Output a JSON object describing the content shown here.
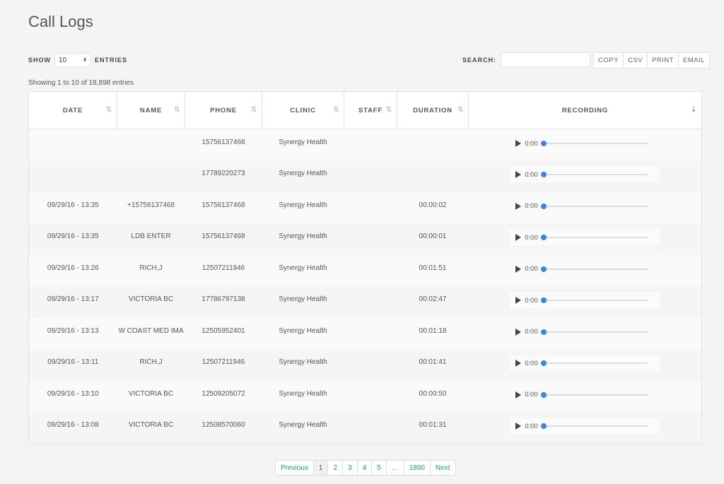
{
  "title": "Call Logs",
  "show": {
    "label": "SHOW",
    "value": "10",
    "suffix": "ENTRIES"
  },
  "search": {
    "label": "SEARCH:",
    "value": ""
  },
  "buttons": [
    "COPY",
    "CSV",
    "PRINT",
    "EMAIL"
  ],
  "info": "Showing 1 to 10 of 18,898 entries",
  "columns": [
    "DATE",
    "NAME",
    "PHONE",
    "CLINIC",
    "STAFF",
    "DURATION",
    "RECORDING"
  ],
  "rows": [
    {
      "date": "",
      "name": "",
      "phone": "15756137468",
      "clinic": "Synergy Health",
      "staff": "",
      "duration": "",
      "time": "0:00"
    },
    {
      "date": "",
      "name": "",
      "phone": "17789220273",
      "clinic": "Synergy Health",
      "staff": "",
      "duration": "",
      "time": "0:00"
    },
    {
      "date": "09/29/16 - 13:35",
      "name": "+15756137468",
      "phone": "15756137468",
      "clinic": "Synergy Health",
      "staff": "",
      "duration": "00:00:02",
      "time": "0:00"
    },
    {
      "date": "09/29/16 - 13:35",
      "name": "LDB ENTER",
      "phone": "15756137468",
      "clinic": "Synergy Health",
      "staff": "",
      "duration": "00:00:01",
      "time": "0:00"
    },
    {
      "date": "09/29/16 - 13:26",
      "name": "RICH,J",
      "phone": "12507211946",
      "clinic": "Synergy Health",
      "staff": "",
      "duration": "00:01:51",
      "time": "0:00"
    },
    {
      "date": "09/29/16 - 13:17",
      "name": "VICTORIA BC",
      "phone": "17786797138",
      "clinic": "Synergy Health",
      "staff": "",
      "duration": "00:02:47",
      "time": "0:00"
    },
    {
      "date": "09/29/16 - 13:13",
      "name": "W COAST MED IMA",
      "phone": "12505952401",
      "clinic": "Synergy Health",
      "staff": "",
      "duration": "00:01:18",
      "time": "0:00"
    },
    {
      "date": "09/29/16 - 13:11",
      "name": "RICH,J",
      "phone": "12507211946",
      "clinic": "Synergy Health",
      "staff": "",
      "duration": "00:01:41",
      "time": "0:00"
    },
    {
      "date": "09/29/16 - 13:10",
      "name": "VICTORIA BC",
      "phone": "12509205072",
      "clinic": "Synergy Health",
      "staff": "",
      "duration": "00:00:50",
      "time": "0:00"
    },
    {
      "date": "09/29/16 - 13:08",
      "name": "VICTORIA BC",
      "phone": "12508570060",
      "clinic": "Synergy Health",
      "staff": "",
      "duration": "00:01:31",
      "time": "0:00"
    }
  ],
  "pagination": {
    "items": [
      "Previous",
      "1",
      "2",
      "3",
      "4",
      "5",
      "…",
      "1890",
      "Next"
    ],
    "active": "1"
  },
  "colors": {
    "accent": "#1aa37a",
    "progress": "#3b82f6"
  }
}
